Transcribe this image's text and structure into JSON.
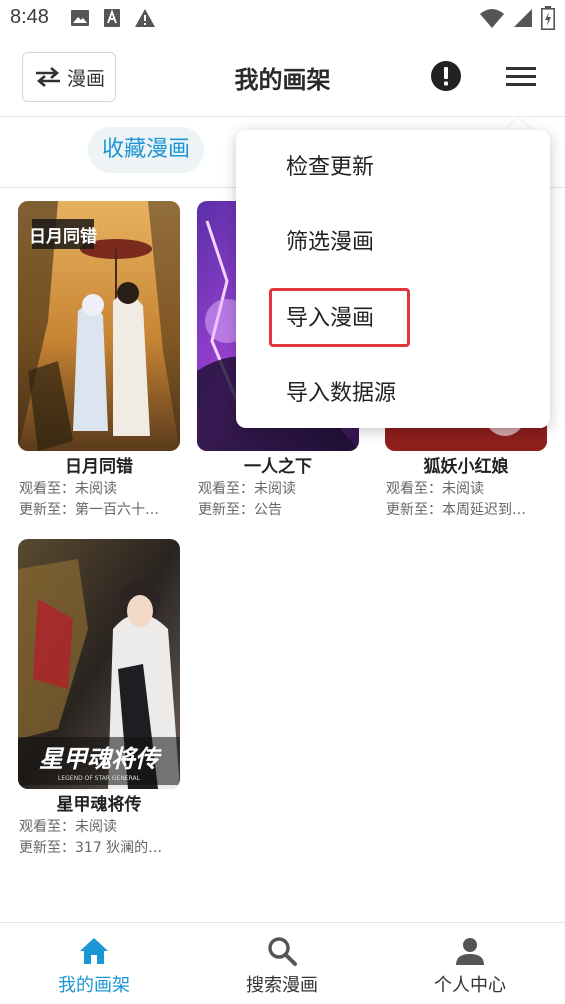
{
  "status_bar": {
    "time": "8:48",
    "icons": [
      "image-icon",
      "a-icon",
      "warning-icon",
      "wifi-icon",
      "signal-icon",
      "battery-icon"
    ]
  },
  "app_bar": {
    "switch_label": "漫画",
    "title": "我的画架"
  },
  "filter": {
    "active_chip": "收藏漫画"
  },
  "comics": [
    {
      "title": "日月同错",
      "watched": "观看至：未阅读",
      "updated": "更新至：第一百六十…"
    },
    {
      "title": "一人之下",
      "watched": "观看至：未阅读",
      "updated": "更新至：公告"
    },
    {
      "title": "狐妖小红娘",
      "watched": "观看至：未阅读",
      "updated": "更新至：本周延迟到…"
    },
    {
      "title": "星甲魂将传",
      "watched": "观看至：未阅读",
      "updated": "更新至：317 狄澜的…"
    }
  ],
  "cover_text": {
    "comic1": "日月同错",
    "comic4": "星甲魂将传",
    "comic4_sub": "LEGEND OF STAR GENERAL"
  },
  "dropdown": {
    "items": [
      "检查更新",
      "筛选漫画",
      "导入漫画",
      "导入数据源"
    ]
  },
  "bottom_nav": {
    "items": [
      "我的画架",
      "搜索漫画",
      "个人中心"
    ],
    "active_color": "#1c97d6"
  },
  "colors": {
    "accent": "#1c97d6",
    "highlight": "#e0373c"
  }
}
